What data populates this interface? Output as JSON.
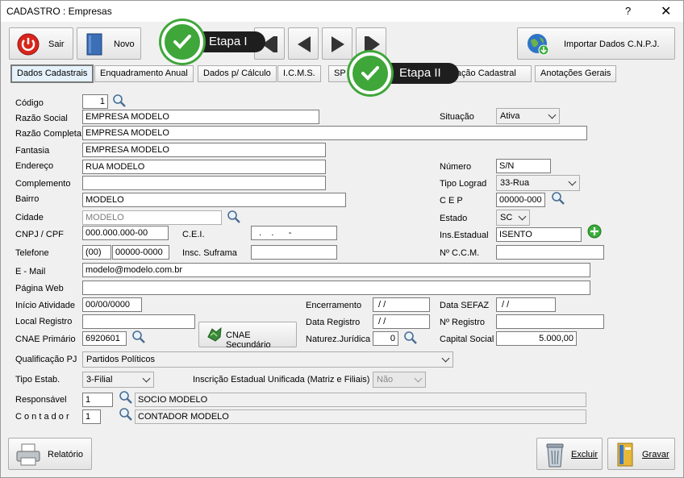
{
  "window": {
    "title": "CADASTRO : Empresas",
    "help": "?",
    "close": "✕"
  },
  "toolbar": {
    "sair": "Sair",
    "novo": "Novo",
    "importar": "Importar Dados C.N.P.J."
  },
  "callouts": {
    "etapa1": "Etapa I",
    "etapa2": "Etapa II"
  },
  "tabs": [
    "Dados Cadastrais",
    "Enquadramento Anual",
    "Dados p/ Cálculo",
    "I.C.M.S.",
    "SP",
    "eração Cadastral",
    "Anotações Gerais"
  ],
  "labels": {
    "codigo": "Código",
    "razao_social": "Razão Social",
    "razao_completa": "Razão Completa",
    "fantasia": "Fantasia",
    "endereco": "Endereço",
    "complemento": "Complemento",
    "bairro": "Bairro",
    "cidade": "Cidade",
    "cnpj": "CNPJ / CPF",
    "cei": "C.E.I.",
    "telefone": "Telefone",
    "suframa": "Insc. Suframa",
    "email": "E - Mail",
    "pagina": "Página Web",
    "inicio": "Início Atividade",
    "encerramento": "Encerramento",
    "data_sefaz": "Data SEFAZ",
    "local_registro": "Local Registro",
    "data_registro": "Data Registro",
    "n_registro": "Nº Registro",
    "cnae": "CNAE Primário",
    "cnae_sec": "CNAE Secundário",
    "natureza": "Naturez.Jurídica",
    "capital": "Capital Social",
    "qualificacao": "Qualificação PJ",
    "tipo_estab": "Tipo Estab.",
    "ie_unificada": "Inscrição Estadual Unificada (Matriz e Filiais)",
    "responsavel": "Responsável",
    "contador": "C o n t a d o r",
    "situacao": "Situação",
    "numero": "Número",
    "tipo_lograd": "Tipo Lograd",
    "cep": "C E P",
    "estado": "Estado",
    "ins_estadual": "Ins.Estadual",
    "ccm": "Nº  C.C.M."
  },
  "values": {
    "codigo": "1",
    "razao_social": "EMPRESA MODELO",
    "razao_completa": "EMPRESA MODELO",
    "fantasia": "EMPRESA MODELO",
    "endereco": "RUA MODELO",
    "complemento": "",
    "bairro": "MODELO",
    "cidade": "MODELO",
    "cnpj": "000.000.000-00",
    "cei": "  .    .      -",
    "tel_ddd": "(00)",
    "tel_num": "00000-0000",
    "suframa": "",
    "email": "modelo@modelo.com.br",
    "pagina": "",
    "inicio": "00/00/0000",
    "encerramento": " / /",
    "data_sefaz": " / /",
    "local_registro": "",
    "data_registro": " / /",
    "n_registro": "",
    "cnae": "6920601",
    "natureza": "0",
    "capital": "5.000,00",
    "qualificacao": "Partidos Políticos",
    "tipo_estab": "3-Filial",
    "ie_unificada": "Não",
    "responsavel_cod": "1",
    "responsavel_nome": "SOCIO MODELO",
    "contador_cod": "1",
    "contador_nome": "CONTADOR MODELO",
    "situacao": "Ativa",
    "numero": "S/N",
    "tipo_lograd": "33-Rua",
    "cep": "00000-000",
    "estado": "SC",
    "ins_estadual": "ISENTO",
    "ccm": ""
  },
  "footer": {
    "relatorio": "Relatório",
    "excluir": "Excluir",
    "gravar": "Gravar"
  },
  "colors": {
    "callout": "#1e1e1e",
    "check": "#3fa63a",
    "tab_active": "#e5f1fb"
  }
}
